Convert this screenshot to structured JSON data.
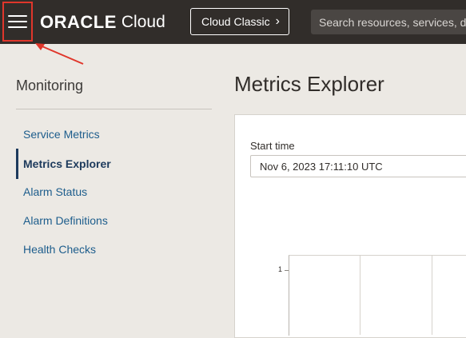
{
  "header": {
    "logo_brand": "ORACLE",
    "logo_product": "Cloud",
    "classic_button_label": "Cloud Classic",
    "classic_button_chevron": "›",
    "search_placeholder": "Search resources, services, do",
    "annotation_color": "#e0362b"
  },
  "sidebar": {
    "title": "Monitoring",
    "items": [
      {
        "label": "Service Metrics",
        "active": false
      },
      {
        "label": "Metrics Explorer",
        "active": true
      },
      {
        "label": "Alarm Status",
        "active": false
      },
      {
        "label": "Alarm Definitions",
        "active": false
      },
      {
        "label": "Health Checks",
        "active": false
      }
    ]
  },
  "main": {
    "title": "Metrics Explorer",
    "start_time_label": "Start time",
    "start_time_value": "Nov 6, 2023 17:11:10 UTC",
    "chart_y_tick": "1"
  },
  "colors": {
    "topbar": "#312d2a",
    "link": "#1d5d8c",
    "active": "#1d3a5c"
  }
}
